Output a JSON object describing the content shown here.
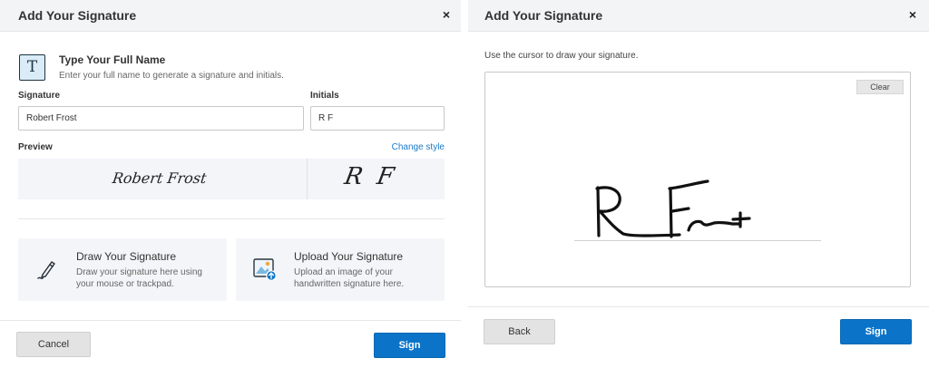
{
  "left_panel": {
    "title": "Add Your Signature",
    "close_glyph": "×",
    "type_section": {
      "icon": "text-T-icon",
      "icon_glyph": "T",
      "heading": "Type Your Full Name",
      "description": "Enter your full name to generate a signature and initials."
    },
    "signature_label": "Signature",
    "signature_value": "Robert Frost",
    "initials_label": "Initials",
    "initials_value": "R F",
    "preview_label": "Preview",
    "change_style_link": "Change style",
    "preview_signature": "Robert Frost",
    "preview_initials": "R F",
    "options": [
      {
        "icon": "pen-draw-icon",
        "title": "Draw Your Signature",
        "description": "Draw your signature here using your mouse or trackpad."
      },
      {
        "icon": "image-upload-icon",
        "title": "Upload Your Signature",
        "description": "Upload an image of your handwritten signature here."
      }
    ],
    "cancel_label": "Cancel",
    "sign_label": "Sign"
  },
  "right_panel": {
    "title": "Add Your Signature",
    "close_glyph": "×",
    "instructions": "Use the cursor to draw your signature.",
    "clear_label": "Clear",
    "back_label": "Back",
    "sign_label": "Sign"
  },
  "colors": {
    "header_bg": "#f3f4f6",
    "accent_blue": "#0b74c8",
    "link_blue": "#1a7ac9",
    "card_bg": "#f4f5f9",
    "icon_fill": "#d9ecf7"
  }
}
